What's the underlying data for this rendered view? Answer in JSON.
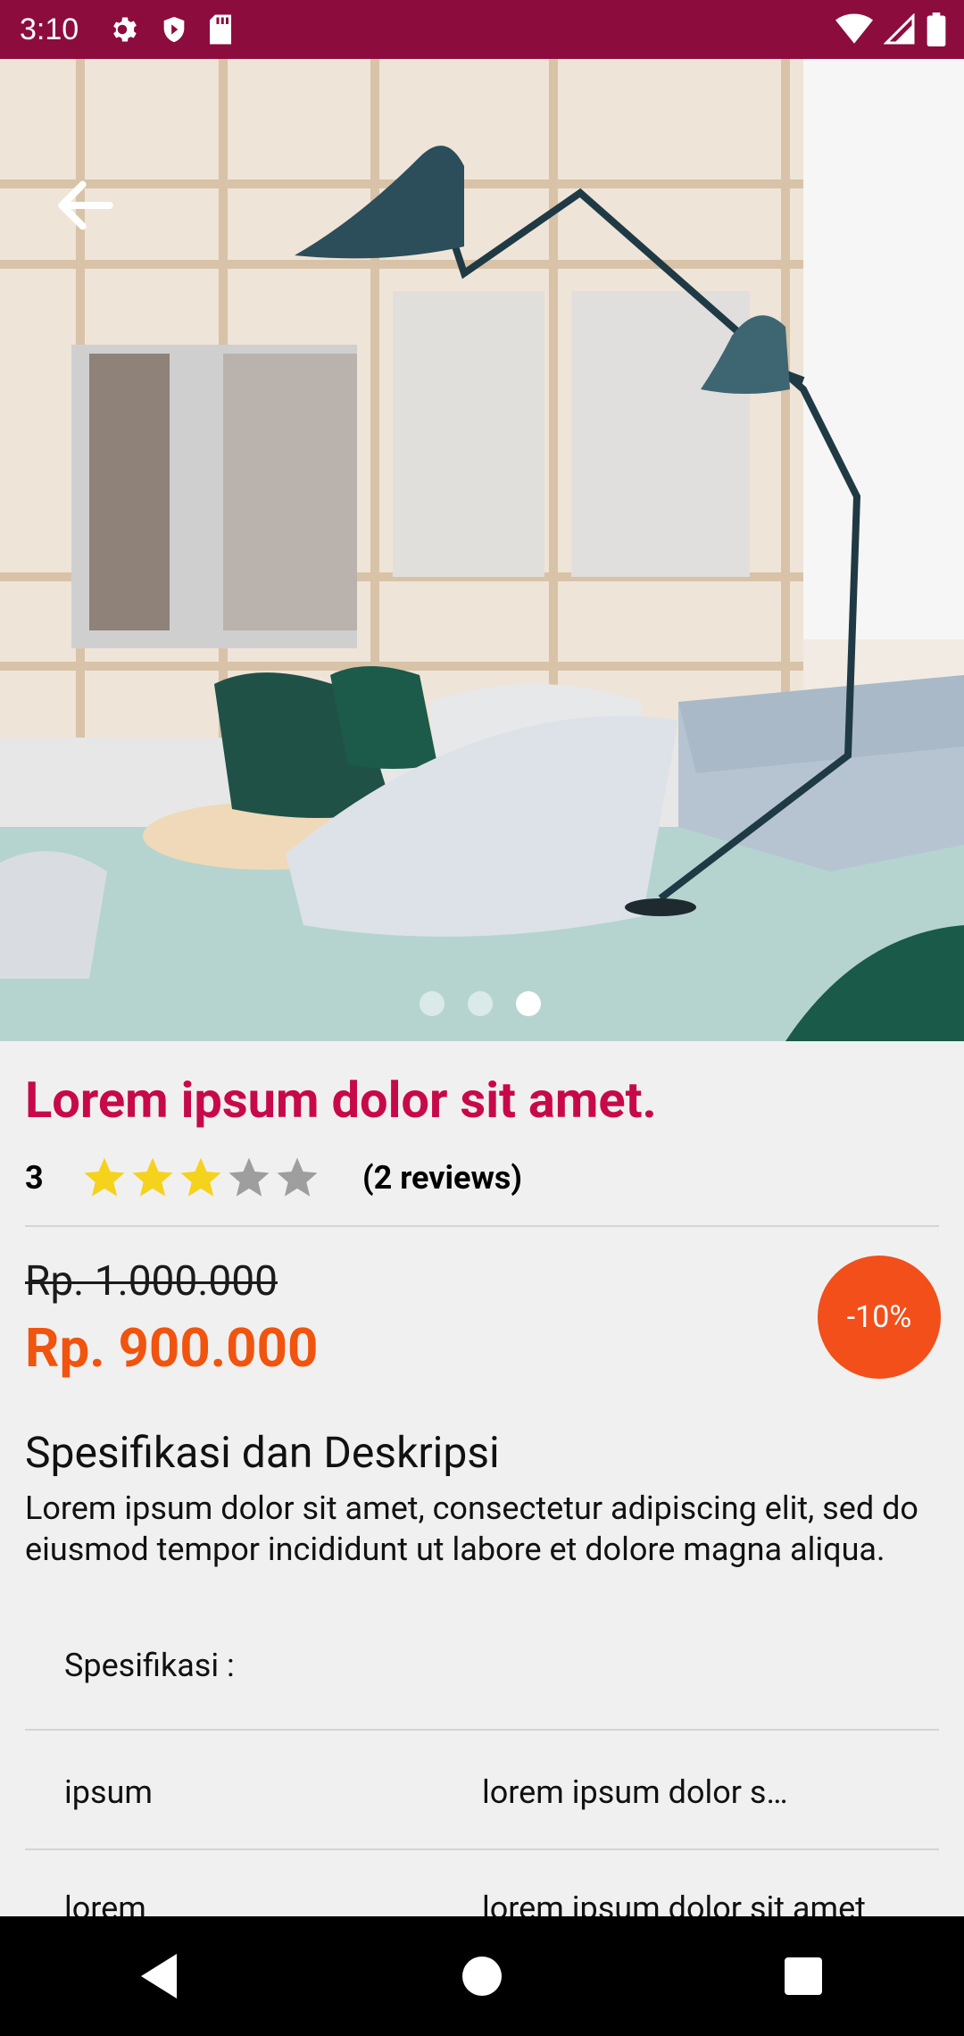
{
  "status_bar": {
    "time": "3:10",
    "left_icons": [
      "settings-icon",
      "shield-icon",
      "sd-card-icon"
    ],
    "right_icons": [
      "wifi-icon",
      "cell-signal-icon",
      "battery-icon"
    ]
  },
  "hero": {
    "image_subject": "living room with chairs and floor lamp",
    "slides": 3,
    "active_slide": 3
  },
  "product": {
    "title": "Lorem ipsum dolor sit amet.",
    "rating": "3",
    "rating_stars": 3,
    "rating_max": 5,
    "reviews": "(2 reviews)",
    "old_price": "Rp. 1.000.000",
    "new_price": "Rp. 900.000",
    "discount": "-10%"
  },
  "description": {
    "heading": "Spesifikasi dan Deskripsi",
    "text": "Lorem ipsum dolor sit amet, consectetur adipiscing elit, sed do eiusmod tempor incididunt ut labore et dolore magna aliqua.",
    "spec_label": "Spesifikasi :",
    "specs": [
      {
        "key": "ipsum",
        "value": "lorem ipsum dolor s…"
      },
      {
        "key": "lorem",
        "value": "lorem ipsum dolor sit amet"
      }
    ]
  },
  "colors": {
    "status_bar": "#8c0c3e",
    "title": "#c7094a",
    "price": "#f0540f",
    "discount_badge": "#f24f1a",
    "star_filled": "#f5d21c",
    "star_empty": "#9e9e9e"
  },
  "nav": [
    "back-icon",
    "home-icon",
    "recents-icon"
  ]
}
